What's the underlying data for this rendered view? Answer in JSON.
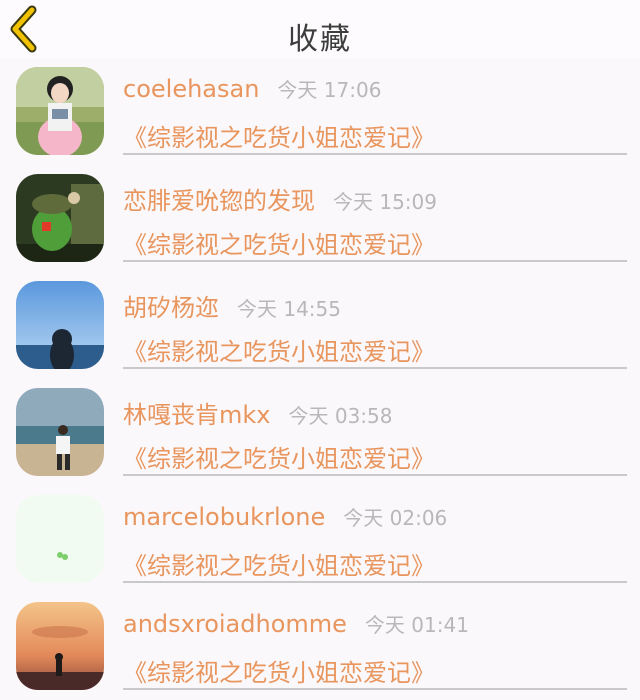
{
  "nav": {
    "title": "收藏",
    "back_icon": "chevron-left-icon"
  },
  "colors": {
    "accent": "#e8955e",
    "back_arrow": "#f2c200",
    "time": "#b8b8b8",
    "divider": "#c9c9c9"
  },
  "items": [
    {
      "name": "coelehasan",
      "time": "今天 17:06",
      "book": "《综影视之吃货小姐恋爱记》",
      "avatar": "girl-photo"
    },
    {
      "name": "恋腓爱吮锪的发现",
      "time": "今天 15:09",
      "book": "《综影视之吃货小姐恋爱记》",
      "avatar": "toy-soldier-photo"
    },
    {
      "name": "胡矽杨迩",
      "time": "今天 14:55",
      "book": "《综影视之吃货小姐恋爱记》",
      "avatar": "sky-person-photo"
    },
    {
      "name": "林嘎丧肯mkx",
      "time": "今天 03:58",
      "book": "《综影视之吃货小姐恋爱记》",
      "avatar": "beach-person-photo"
    },
    {
      "name": "marcelobukrlone",
      "time": "今天 02:06",
      "book": "《综影视之吃货小姐恋爱记》",
      "avatar": "green-dots-photo"
    },
    {
      "name": "andsxroiadhomme",
      "time": "今天 01:41",
      "book": "《综影视之吃货小姐恋爱记》",
      "avatar": "sunset-photo"
    }
  ]
}
